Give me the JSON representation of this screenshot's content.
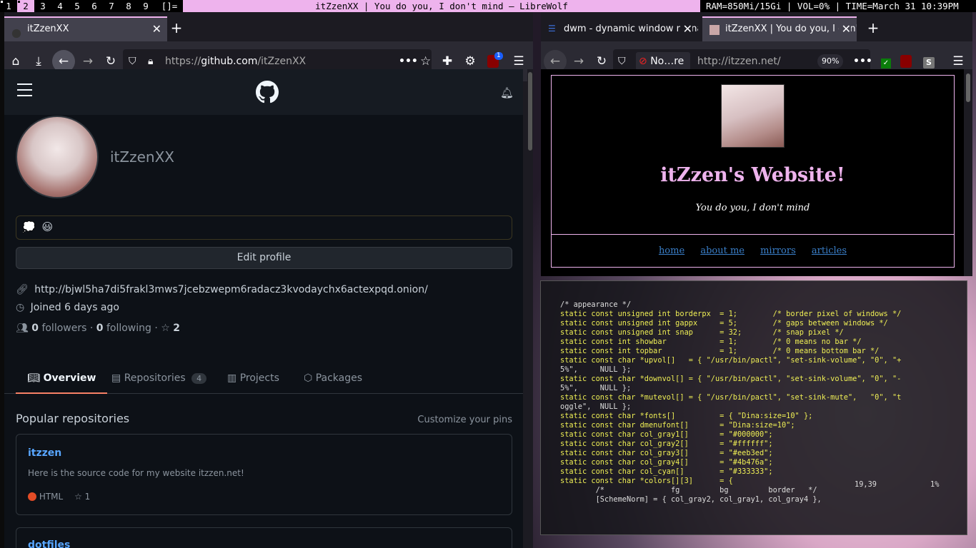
{
  "bar": {
    "tags": [
      "1",
      "2",
      "3",
      "4",
      "5",
      "6",
      "7",
      "8",
      "9"
    ],
    "selected_tag": "2",
    "layout": "[]=",
    "window_title": "itZzenXX | You do you, I don't mind — LibreWolf",
    "status": "RAM=850Mi/15Gi | VOL=0% | TIME=March 31 10:39PM"
  },
  "left_browser": {
    "tab_title": "itZzenXX",
    "url_prefix": "https://",
    "url_host": "github.com",
    "url_path": "/itZzenXX",
    "ublock_badge": "1",
    "github": {
      "username": "itZzenXX",
      "status_emoji": "💭",
      "status_text_emoji": "😃",
      "edit_profile_label": "Edit profile",
      "onion_link": "http://bjwl5ha7di5frakl3mws7jcebzwepm6radacz3kvodaychx6actexpqd.onion/",
      "joined": "Joined 6 days ago",
      "followers_count": "0",
      "followers_label": "followers",
      "following_count": "0",
      "following_label": "following",
      "stars_count": "2",
      "tabs": [
        {
          "label": "Overview",
          "count": ""
        },
        {
          "label": "Repositories",
          "count": "4"
        },
        {
          "label": "Projects",
          "count": ""
        },
        {
          "label": "Packages",
          "count": ""
        }
      ],
      "popular_title": "Popular repositories",
      "customize_pins": "Customize your pins",
      "repo": {
        "name": "itzzen",
        "description": "Here is the source code for my website itzzen.net!",
        "language": "HTML",
        "language_color": "#e34c26",
        "stars": "1"
      },
      "repo2_name": "dotfiles"
    }
  },
  "right_browser": {
    "tab1_title": "dwm - dynamic window manager",
    "tab2_title": "itZzenXX | You do you, I don't mind",
    "noscript_label": "No…re",
    "url": "http://itzzen.net/",
    "zoom": "90%",
    "site": {
      "title": "itZzen's Website!",
      "subtitle": "You do you, I don't mind",
      "nav": [
        "home",
        "about me",
        "mirrors",
        "articles"
      ]
    }
  },
  "terminal": {
    "lines": [
      "/* appearance */",
      "static const unsigned int borderpx  = 1;        /* border pixel of windows */",
      "static const unsigned int gappx     = 5;        /* gaps between windows */",
      "static const unsigned int snap      = 32;       /* snap pixel */",
      "static const int showbar            = 1;        /* 0 means no bar */",
      "static const int topbar             = 1;        /* 0 means bottom bar */",
      "static const char *upvol[]   = { \"/usr/bin/pactl\", \"set-sink-volume\", \"0\", \"+",
      "5%\",     NULL };",
      "static const char *downvol[] = { \"/usr/bin/pactl\", \"set-sink-volume\", \"0\", \"-",
      "5%\",     NULL };",
      "static const char *mutevol[] = { \"/usr/bin/pactl\", \"set-sink-mute\",   \"0\", \"t",
      "oggle\",  NULL };",
      "static const char *fonts[]          = { \"Dina:size=10\" };",
      "static const char dmenufont[]       = \"Dina:size=10\";",
      "static const char col_gray1[]       = \"#000000\";",
      "static const char col_gray2[]       = \"#ffffff\";",
      "static const char col_gray3[]       = \"#eeb3ed\";",
      "static const char col_gray4[]       = \"#4b476a\";",
      "static const char col_cyan[]        = \"#333333\";",
      "static const char *colors[][3]      = {",
      "        /*               fg         bg         border   */",
      "        [SchemeNorm] = { col_gray2, col_gray1, col_gray4 },"
    ],
    "cursor_pos": "19,39",
    "percent": "1%"
  },
  "colors": {
    "accent_pink": "#eeb3ed",
    "github_bg": "#0d1117",
    "github_link": "#58a6ff"
  }
}
